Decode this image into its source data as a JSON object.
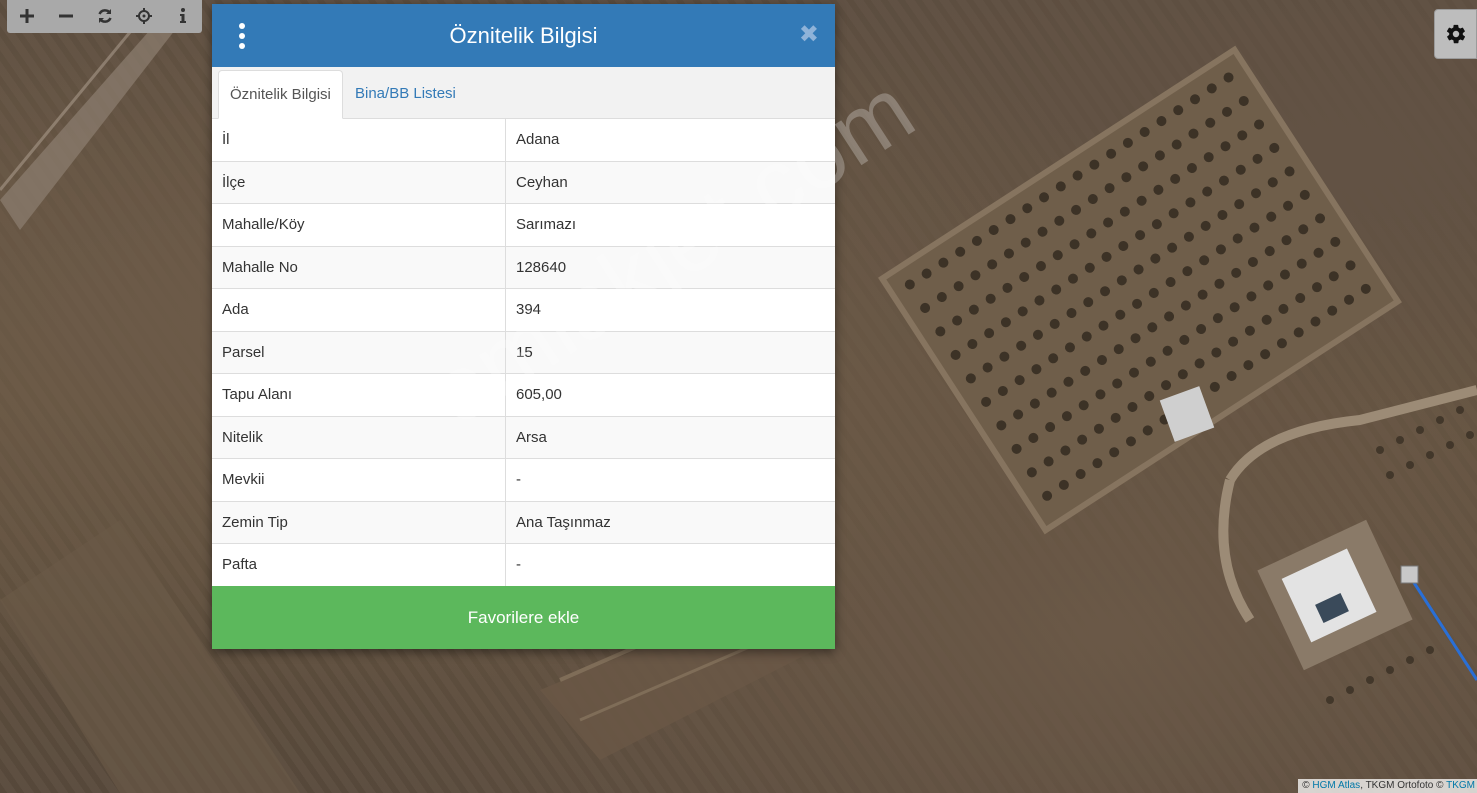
{
  "toolbar": {
    "buttons": [
      {
        "icon": "zoom-in-icon"
      },
      {
        "icon": "zoom-out-icon"
      },
      {
        "icon": "refresh-icon"
      },
      {
        "icon": "locate-icon"
      },
      {
        "icon": "info-icon"
      }
    ]
  },
  "settings": {
    "icon": "gear-icon"
  },
  "watermark": "emlakjet.com",
  "attribution": {
    "prefix": "© ",
    "link1": "HGM Atlas",
    "middle": ", TKGM Ortofoto © ",
    "link2": "TKGM"
  },
  "modal": {
    "title": "Öznitelik Bilgisi",
    "tabs": [
      {
        "label": "Öznitelik Bilgisi",
        "active": true
      },
      {
        "label": "Bina/BB Listesi",
        "active": false
      }
    ],
    "rows": [
      {
        "key": "İl",
        "value": "Adana"
      },
      {
        "key": "İlçe",
        "value": "Ceyhan"
      },
      {
        "key": "Mahalle/Köy",
        "value": "Sarımazı"
      },
      {
        "key": "Mahalle No",
        "value": "128640"
      },
      {
        "key": "Ada",
        "value": "394"
      },
      {
        "key": "Parsel",
        "value": "15"
      },
      {
        "key": "Tapu Alanı",
        "value": "605,00"
      },
      {
        "key": "Nitelik",
        "value": "Arsa"
      },
      {
        "key": "Mevkii",
        "value": "-"
      },
      {
        "key": "Zemin Tip",
        "value": "Ana Taşınmaz"
      },
      {
        "key": "Pafta",
        "value": "-"
      }
    ],
    "favorite_label": "Favorilere ekle"
  },
  "colors": {
    "header_blue": "#337ab7",
    "favorite_green": "#5cb85c",
    "parcel_line": "#2a6fd6"
  }
}
